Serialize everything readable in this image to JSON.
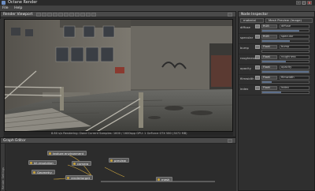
{
  "window": {
    "title": "Octane Render"
  },
  "menu": [
    "File",
    "Help"
  ],
  "render_viewport": {
    "title": "Render Viewport",
    "status_text": "8.80 s/s   Rendering: Done   Current Samples: 1600 / 1600spp   GPU: 1 GeForce GTX 580 (3072 MB)"
  },
  "node_inspector": {
    "title": "Node Inspector",
    "tabs": [
      "material",
      "Mesh Preview (Image)"
    ],
    "rows": [
      {
        "label": "diffuse",
        "type": "RGB",
        "name": "diffuse",
        "level": 0.8
      },
      {
        "label": "specular",
        "type": "RGB",
        "name": "specular",
        "level": 0.6
      },
      {
        "label": "bump",
        "type": "Float",
        "name": "bump",
        "level": 0.0
      },
      {
        "label": "roughness",
        "type": "Float",
        "name": "roughness",
        "level": 0.5
      },
      {
        "label": "opacity",
        "type": "Float",
        "name": "opacity",
        "level": 1.0
      },
      {
        "label": "filmwidth",
        "type": "Float",
        "name": "filmwidth",
        "level": 0.2
      },
      {
        "label": "index",
        "type": "Float",
        "name": "index",
        "level": 0.4
      }
    ]
  },
  "graph_editor": {
    "title": "Graph Editor",
    "sidebar_label": "Render Settings",
    "nodes": [
      {
        "id": "env",
        "label": "texture environment"
      },
      {
        "id": "kern",
        "label": "kit.resolution"
      },
      {
        "id": "cam",
        "label": "camera"
      },
      {
        "id": "prev",
        "label": "preview"
      },
      {
        "id": "geo",
        "label": "Geometry"
      },
      {
        "id": "mat",
        "label": "rendertarget"
      },
      {
        "id": "mesh",
        "label": "mesh"
      }
    ]
  }
}
